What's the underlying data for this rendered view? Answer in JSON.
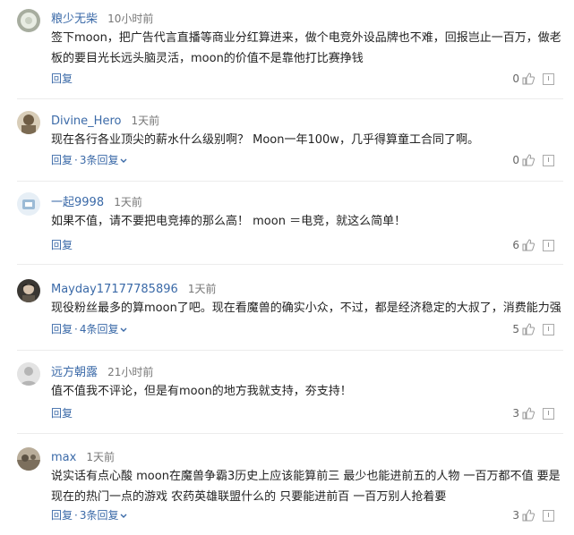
{
  "comments": [
    {
      "user": "粮少无柴",
      "time": "10小时前",
      "text": "签下moon，把广告代言直播等商业分红算进来，做个电竞外设品牌也不难，回报岂止一百万，做老板的要目光长远头脑灵活，moon的价值不是靠他打比赛挣钱",
      "reply_label": "回复",
      "replies_label": "",
      "likes": "0",
      "avatar_color": "#9aa49a"
    },
    {
      "user": "Divine_Hero",
      "time": "1天前",
      "text": "现在各行各业顶尖的薪水什么级别啊？ Moon一年100w，几乎得算童工合同了啊。",
      "reply_label": "回复",
      "replies_label": "3条回复",
      "likes": "0",
      "avatar_color": "#7a6a52"
    },
    {
      "user": "一起9998",
      "time": "1天前",
      "text": "如果不值，请不要把电竞捧的那么高！ moon ＝电竞，就这么简单！",
      "reply_label": "回复",
      "replies_label": "",
      "likes": "6",
      "avatar_color": "#bcd3e6"
    },
    {
      "user": "Mayday17177785896",
      "time": "1天前",
      "text": "现役粉丝最多的算moon了吧。现在看魔兽的确实小众，不过，都是经济稳定的大叔了，消费能力强",
      "reply_label": "回复",
      "replies_label": "4条回复",
      "likes": "5",
      "avatar_color": "#4a4640"
    },
    {
      "user": "远方朝露",
      "time": "21小时前",
      "text": "值不值我不评论，但是有moon的地方我就支持，夯支持！",
      "reply_label": "回复",
      "replies_label": "",
      "likes": "3",
      "avatar_color": "#d9d9d9"
    },
    {
      "user": "max",
      "time": "1天前",
      "text": "说实话有点心酸 moon在魔兽争霸3历史上应该能算前三 最少也能进前五的人物 一百万都不值 要是现在的热门一点的游戏 农药英雄联盟什么的 只要能进前百 一百万别人抢着要",
      "reply_label": "回复",
      "replies_label": "3条回复",
      "likes": "3",
      "avatar_color": "#8a7f70"
    }
  ],
  "separator": "·",
  "colors": {
    "link": "#3b6aa8",
    "text": "#222222",
    "muted": "#777777",
    "divider": "#ececec"
  },
  "icons": {
    "like": "thumbs-up-icon",
    "report": "report-icon",
    "expand": "chevron-down-icon"
  }
}
